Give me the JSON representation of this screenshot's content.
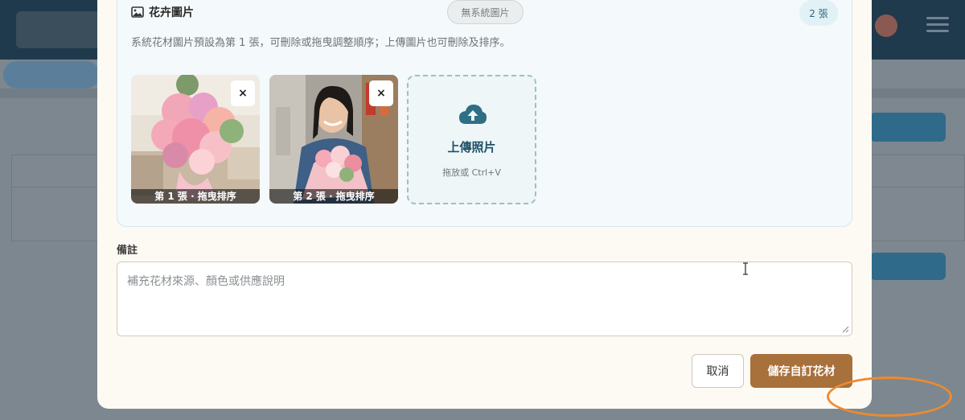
{
  "colors": {
    "accent": "#a8703b",
    "badge_bg": "#e2f1f5",
    "upload_icon": "#2f6f84",
    "annotation_ring": "#ee8a2e"
  },
  "image_section": {
    "title": "花卉圖片",
    "icon": "image-icon",
    "no_system_badge": "無系統圖片",
    "count_badge": "2 張",
    "hint": "系統花材圖片預設為第 1 張，可刪除或拖曳調整順序；上傳圖片也可刪除及排序。",
    "photos": [
      {
        "caption": "第 1 張 · 拖曳排序",
        "remove_label": "×",
        "subject": "flower-basket-photo"
      },
      {
        "caption": "第 2 張 · 拖曳排序",
        "remove_label": "×",
        "subject": "woman-with-bouquet-photo"
      }
    ],
    "upload": {
      "icon": "cloud-upload-icon",
      "title": "上傳照片",
      "subtitle": "拖放或 Ctrl+V"
    }
  },
  "notes": {
    "label": "備註",
    "placeholder": "補充花材來源、顏色或供應說明",
    "value": ""
  },
  "actions": {
    "cancel": "取消",
    "save": "儲存自訂花材"
  }
}
